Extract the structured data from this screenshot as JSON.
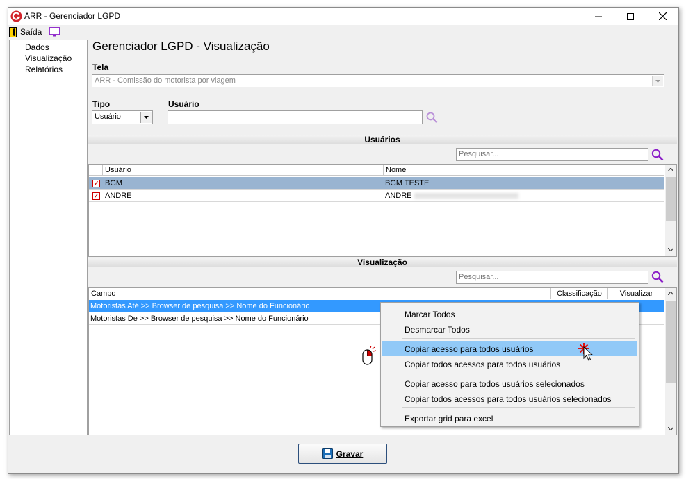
{
  "window": {
    "title": "ARR - Gerenciador LGPD"
  },
  "toolbar": {
    "exit_label": "Saída"
  },
  "sidebar": {
    "items": [
      {
        "label": "Dados"
      },
      {
        "label": "Visualização"
      },
      {
        "label": "Relatórios"
      }
    ]
  },
  "main": {
    "heading": "Gerenciador LGPD - Visualização",
    "tela": {
      "label": "Tela",
      "value": "ARR - Comissão do motorista por viagem"
    },
    "tipo": {
      "label": "Tipo",
      "value": "Usuário"
    },
    "usuario": {
      "label": "Usuário",
      "value": ""
    }
  },
  "users_section": {
    "title": "Usuários",
    "search_placeholder": "Pesquisar...",
    "columns": [
      "Usuário",
      "Nome"
    ],
    "rows": [
      {
        "user": "BGM",
        "name": "BGM TESTE",
        "checked": true,
        "selected": true
      },
      {
        "user": "ANDRE",
        "name": "ANDRE",
        "checked": true,
        "selected": false
      }
    ]
  },
  "view_section": {
    "title": "Visualização",
    "search_placeholder": "Pesquisar...",
    "columns": [
      "Campo",
      "Classificação",
      "Visualizar"
    ],
    "rows": [
      {
        "campo": "Motoristas Até >> Browser de pesquisa >> Nome do Funcionário",
        "selected": true
      },
      {
        "campo": "Motoristas De >> Browser de pesquisa >> Nome do Funcionário",
        "selected": false
      }
    ]
  },
  "context_menu": {
    "items": [
      {
        "label": "Marcar Todos"
      },
      {
        "label": "Desmarcar Todos"
      },
      {
        "label": "Copiar acesso para todos usuários"
      },
      {
        "label": "Copiar todos acessos para todos usuários"
      },
      {
        "label": "Copiar acesso para todos usuários selecionados"
      },
      {
        "label": "Copiar todos acessos para todos usuários selecionados"
      },
      {
        "label": "Exportar grid para excel"
      }
    ]
  },
  "footer": {
    "save_label": "Gravar"
  },
  "colors": {
    "selection": "#3399ff",
    "highlight_row": "#99b4d1",
    "menu_hover": "#91c9f7",
    "search_icon": "#8b1fc8"
  }
}
